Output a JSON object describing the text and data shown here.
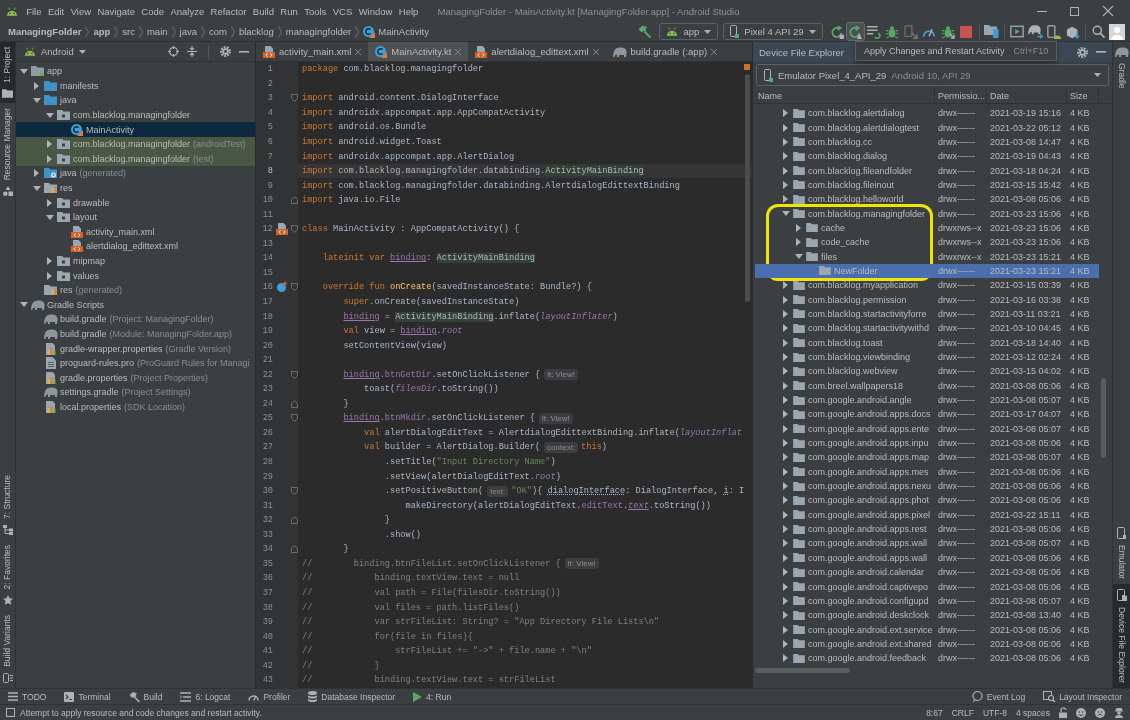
{
  "window": {
    "title": "ManagingFolder - MainActivity.kt [ManagingFolder.app] - Android Studio"
  },
  "menu": [
    "File",
    "Edit",
    "View",
    "Navigate",
    "Code",
    "Analyze",
    "Refactor",
    "Build",
    "Run",
    "Tools",
    "VCS",
    "Window",
    "Help"
  ],
  "breadcrumbs": [
    {
      "label": "ManagingFolder",
      "kind": "module"
    },
    {
      "label": "app",
      "kind": "module"
    },
    {
      "label": "src",
      "kind": "folder"
    },
    {
      "label": "main",
      "kind": "folder"
    },
    {
      "label": "java",
      "kind": "folder"
    },
    {
      "label": "com",
      "kind": "folder"
    },
    {
      "label": "blacklog",
      "kind": "folder"
    },
    {
      "label": "managingfolder",
      "kind": "folder"
    },
    {
      "label": "MainActivity",
      "kind": "class"
    }
  ],
  "run_toolbar": {
    "configuration": "app",
    "device": "Pixel 4 API 29",
    "button_groups": [
      [
        {
          "kind": "apply-code-changes",
          "hovered": false
        },
        {
          "kind": "apply-changes-restart",
          "hovered": true
        },
        {
          "kind": "coverage",
          "hovered": false
        },
        {
          "kind": "debug",
          "hovered": false
        },
        {
          "kind": "attach",
          "hovered": false
        },
        {
          "kind": "profile",
          "hovered": false
        },
        {
          "kind": "attach-debugger",
          "hovered": false
        },
        {
          "kind": "stop",
          "hovered": false
        }
      ],
      [
        {
          "kind": "device-files",
          "hovered": false
        }
      ],
      [
        {
          "kind": "terminal",
          "hovered": false
        },
        {
          "kind": "sync",
          "hovered": false
        },
        {
          "kind": "avd",
          "hovered": false
        },
        {
          "kind": "sdk",
          "hovered": false
        }
      ],
      [
        {
          "kind": "search",
          "hovered": false
        },
        {
          "kind": "account",
          "hovered": false
        }
      ]
    ]
  },
  "tooltip": {
    "text": "Apply Changes and Restart Activity",
    "shortcut": "Ctrl+F10"
  },
  "left_tool_tabs": {
    "top": [
      {
        "label": "1: Project",
        "kind": "project",
        "selected": true
      },
      {
        "label": "Resource Manager",
        "kind": "resources",
        "selected": false
      }
    ],
    "bottom": [
      {
        "label": "7: Structure",
        "kind": "structure",
        "selected": false
      },
      {
        "label": "2: Favorites",
        "kind": "favorites",
        "selected": false
      },
      {
        "label": "Build Variants",
        "kind": "variants",
        "selected": false
      }
    ]
  },
  "project_panel": {
    "view": "Android",
    "tree": [
      {
        "label": "app",
        "kind": "module",
        "expanded": true,
        "selected": false,
        "test_scope": false,
        "children": [
          {
            "label": "manifests",
            "kind": "folder",
            "expanded": false,
            "selected": false,
            "test_scope": false
          },
          {
            "label": "java",
            "kind": "folder",
            "expanded": true,
            "selected": false,
            "test_scope": false,
            "children": [
              {
                "label": "com.blacklog.managingfolder",
                "kind": "package",
                "expanded": true,
                "selected": false,
                "test_scope": false,
                "children": [
                  {
                    "label": "MainActivity",
                    "kind": "kotlin-class",
                    "selected": true,
                    "test_scope": false
                  }
                ]
              },
              {
                "label": "com.blacklog.managingfolder",
                "note": "(androidTest)",
                "kind": "package",
                "expanded": false,
                "selected": false,
                "test_scope": true
              },
              {
                "label": "com.blacklog.managingfolder",
                "note": "(test)",
                "kind": "package",
                "expanded": false,
                "selected": false,
                "test_scope": true
              }
            ]
          },
          {
            "label": "java",
            "note": "(generated)",
            "kind": "generated-folder",
            "expanded": false,
            "selected": false,
            "test_scope": false
          },
          {
            "label": "res",
            "kind": "res-folder",
            "expanded": true,
            "selected": false,
            "test_scope": false,
            "children": [
              {
                "label": "drawable",
                "kind": "package",
                "expanded": false,
                "selected": false,
                "test_scope": false
              },
              {
                "label": "layout",
                "kind": "package",
                "expanded": true,
                "selected": false,
                "test_scope": false,
                "children": [
                  {
                    "label": "activity_main.xml",
                    "kind": "xml",
                    "selected": false,
                    "test_scope": false
                  },
                  {
                    "label": "alertdialog_edittext.xml",
                    "kind": "xml",
                    "selected": false,
                    "test_scope": false
                  }
                ]
              },
              {
                "label": "mipmap",
                "kind": "package",
                "expanded": false,
                "selected": false,
                "test_scope": false
              },
              {
                "label": "values",
                "kind": "package",
                "expanded": false,
                "selected": false,
                "test_scope": false
              }
            ]
          },
          {
            "label": "res",
            "note": "(generated)",
            "kind": "res-folder",
            "selected": false,
            "test_scope": false
          }
        ]
      },
      {
        "label": "Gradle Scripts",
        "kind": "gradle",
        "expanded": true,
        "selected": false,
        "test_scope": false,
        "children": [
          {
            "label": "build.gradle",
            "note": "(Project: ManagingFolder)",
            "kind": "gradle",
            "selected": false,
            "test_scope": false
          },
          {
            "label": "build.gradle",
            "note": "(Module: ManagingFolder.app)",
            "kind": "gradle",
            "selected": false,
            "test_scope": false
          },
          {
            "label": "gradle-wrapper.properties",
            "note": "(Gradle Version)",
            "kind": "properties",
            "selected": false,
            "test_scope": false
          },
          {
            "label": "proguard-rules.pro",
            "note": "(ProGuard Rules for Managi",
            "kind": "text",
            "selected": false,
            "test_scope": false
          },
          {
            "label": "gradle.properties",
            "note": "(Project Properties)",
            "kind": "properties",
            "selected": false,
            "test_scope": false
          },
          {
            "label": "settings.gradle",
            "note": "(Project Settings)",
            "kind": "gradle",
            "selected": false,
            "test_scope": false
          },
          {
            "label": "local.properties",
            "note": "(SDK Location)",
            "kind": "properties",
            "selected": false,
            "test_scope": false
          }
        ]
      }
    ]
  },
  "editor": {
    "tabs": [
      {
        "label": "activity_main.xml",
        "kind": "xml",
        "selected": false
      },
      {
        "label": "MainActivity.kt",
        "kind": "kotlin",
        "selected": true
      },
      {
        "label": "alertdialog_edittext.xml",
        "kind": "xml",
        "selected": false
      },
      {
        "label": "build.gradle (:app)",
        "kind": "gradle",
        "selected": false
      }
    ],
    "lines": [
      {
        "number": "1",
        "current": false,
        "tokens": [
          {
            "kind": "keyword",
            "text": "package"
          },
          {
            "kind": "plain",
            "text": " com.blacklog.managingfolder"
          }
        ]
      },
      {
        "number": "2",
        "current": false
      },
      {
        "number": "3",
        "current": false,
        "fold_marker": {
          "kind": "start"
        },
        "tokens": [
          {
            "kind": "keyword",
            "text": "import"
          },
          {
            "kind": "plain",
            "text": " android.content.DialogInterface"
          }
        ]
      },
      {
        "number": "4",
        "current": false,
        "tokens": [
          {
            "kind": "keyword",
            "text": "import"
          },
          {
            "kind": "plain",
            "text": " androidx.appcompat.app.AppCompatActivity"
          }
        ]
      },
      {
        "number": "5",
        "current": false,
        "tokens": [
          {
            "kind": "keyword",
            "text": "import"
          },
          {
            "kind": "plain",
            "text": " android.os.Bundle"
          }
        ]
      },
      {
        "number": "6",
        "current": false,
        "tokens": [
          {
            "kind": "keyword",
            "text": "import"
          },
          {
            "kind": "plain",
            "text": " android.widget.Toast"
          }
        ]
      },
      {
        "number": "7",
        "current": false,
        "tokens": [
          {
            "kind": "keyword",
            "text": "import"
          },
          {
            "kind": "plain",
            "text": " androidx.appcompat.app.AlertDialog"
          }
        ]
      },
      {
        "number": "8",
        "current": true,
        "tokens": [
          {
            "kind": "keyword",
            "text": "import"
          },
          {
            "kind": "plain",
            "text": " com.blacklog.managingfolder.databinding."
          },
          {
            "kind": "type-highlight",
            "text": "ActivityMainBinding"
          }
        ]
      },
      {
        "number": "9",
        "current": false,
        "tokens": [
          {
            "kind": "keyword",
            "text": "import"
          },
          {
            "kind": "plain",
            "text": " com.blacklog.managingfolder.databinding.AlertdialogEdittextBinding"
          }
        ]
      },
      {
        "number": "10",
        "current": false,
        "fold_marker": {
          "kind": "end"
        },
        "tokens": [
          {
            "kind": "keyword",
            "text": "import"
          },
          {
            "kind": "plain",
            "text": " java.io.File"
          }
        ]
      },
      {
        "number": "11",
        "current": false
      },
      {
        "number": "12",
        "current": false,
        "fold_marker": {
          "kind": "start"
        },
        "gutter_marker": {
          "kind": "layout"
        },
        "tokens": [
          {
            "kind": "keyword",
            "text": "class"
          },
          {
            "kind": "plain",
            "text": " MainActivity : AppCompatActivity() {"
          }
        ]
      },
      {
        "number": "13",
        "current": false
      },
      {
        "number": "14",
        "current": false,
        "tokens": [
          {
            "kind": "keyword",
            "text": "    lateinit var "
          },
          {
            "kind": "property-underlined",
            "text": "binding"
          },
          {
            "kind": "plain",
            "text": ": "
          },
          {
            "kind": "type-highlight",
            "text": "ActivityMainBinding"
          }
        ]
      },
      {
        "number": "15",
        "current": false
      },
      {
        "number": "16",
        "current": false,
        "fold_marker": {
          "kind": "start"
        },
        "gutter_marker": {
          "kind": "override"
        },
        "tokens": [
          {
            "kind": "keyword",
            "text": "    override fun "
          },
          {
            "kind": "function",
            "text": "onCreate"
          },
          {
            "kind": "plain",
            "text": "(savedInstanceState: Bundle?) {"
          }
        ]
      },
      {
        "number": "17",
        "current": false,
        "tokens": [
          {
            "kind": "keyword",
            "text": "        super"
          },
          {
            "kind": "plain",
            "text": ".onCreate(savedInstanceState)"
          }
        ]
      },
      {
        "number": "18",
        "current": false,
        "tokens": [
          {
            "kind": "property-underlined",
            "text": "        binding"
          },
          {
            "kind": "plain",
            "text": " = "
          },
          {
            "kind": "type-highlight",
            "text": "ActivityMainBinding"
          },
          {
            "kind": "plain",
            "text": ".inflate("
          },
          {
            "kind": "property-italic",
            "text": "layoutInflater"
          },
          {
            "kind": "plain",
            "text": ")"
          }
        ]
      },
      {
        "number": "19",
        "current": false,
        "tokens": [
          {
            "kind": "keyword",
            "text": "        val"
          },
          {
            "kind": "plain",
            "text": " view = "
          },
          {
            "kind": "property-underlined",
            "text": "binding"
          },
          {
            "kind": "plain",
            "text": "."
          },
          {
            "kind": "property-italic",
            "text": "root"
          }
        ]
      },
      {
        "number": "20",
        "current": false,
        "tokens": [
          {
            "kind": "plain",
            "text": "        setContentView(view)"
          }
        ]
      },
      {
        "number": "21",
        "current": false
      },
      {
        "number": "22",
        "current": false,
        "fold_marker": {
          "kind": "start"
        },
        "tokens": [
          {
            "kind": "property-underlined",
            "text": "        binding"
          },
          {
            "kind": "plain",
            "text": "."
          },
          {
            "kind": "property",
            "text": "btnGetDir"
          },
          {
            "kind": "plain",
            "text": ".setOnClickListener {"
          },
          {
            "kind": "hint",
            "text": "it: View!"
          }
        ]
      },
      {
        "number": "23",
        "current": false,
        "tokens": [
          {
            "kind": "plain",
            "text": "            toast("
          },
          {
            "kind": "property-italic",
            "text": "filesDir"
          },
          {
            "kind": "plain",
            "text": ".toString())"
          }
        ]
      },
      {
        "number": "24",
        "current": false,
        "fold_marker": {
          "kind": "end"
        },
        "tokens": [
          {
            "kind": "plain",
            "text": "        }"
          }
        ]
      },
      {
        "number": "25",
        "current": false,
        "fold_marker": {
          "kind": "start"
        },
        "tokens": [
          {
            "kind": "property-underlined",
            "text": "        binding"
          },
          {
            "kind": "plain",
            "text": "."
          },
          {
            "kind": "property",
            "text": "btnMkdir"
          },
          {
            "kind": "plain",
            "text": ".setOnClickListener {"
          },
          {
            "kind": "hint",
            "text": "it: View!"
          }
        ]
      },
      {
        "number": "26",
        "current": false,
        "tokens": [
          {
            "kind": "keyword",
            "text": "            val"
          },
          {
            "kind": "plain",
            "text": " alertDialogEditText = AlertdialogEdittextBinding.inflate("
          },
          {
            "kind": "property-italic",
            "text": "layoutInflat"
          }
        ]
      },
      {
        "number": "27",
        "current": false,
        "tokens": [
          {
            "kind": "keyword",
            "text": "            val"
          },
          {
            "kind": "plain",
            "text": " builder = AlertDialog.Builder("
          },
          {
            "kind": "hint",
            "text": "context:"
          },
          {
            "kind": "keyword",
            "text": "this"
          },
          {
            "kind": "plain",
            "text": ")"
          }
        ]
      },
      {
        "number": "28",
        "current": false,
        "tokens": [
          {
            "kind": "plain",
            "text": "                .setTitle("
          },
          {
            "kind": "string",
            "text": "\"Input Directory Name\""
          },
          {
            "kind": "plain",
            "text": ")"
          }
        ]
      },
      {
        "number": "29",
        "current": false,
        "tokens": [
          {
            "kind": "plain",
            "text": "                .setView(alertDialogEditText."
          },
          {
            "kind": "property-italic",
            "text": "root"
          },
          {
            "kind": "plain",
            "text": ")"
          }
        ]
      },
      {
        "number": "30",
        "current": false,
        "fold_marker": {
          "kind": "start"
        },
        "tokens": [
          {
            "kind": "plain",
            "text": "                .setPositiveButton("
          },
          {
            "kind": "hint",
            "text": "text:"
          },
          {
            "kind": "string",
            "text": "\"OK\""
          },
          {
            "kind": "plain",
            "text": "){ "
          },
          {
            "kind": "parameter-underlined",
            "text": "dialogInterface"
          },
          {
            "kind": "plain",
            "text": ": DialogInterface, "
          },
          {
            "kind": "parameter-underlined",
            "text": "i"
          },
          {
            "kind": "plain",
            "text": ": I"
          }
        ]
      },
      {
        "number": "31",
        "current": false,
        "tokens": [
          {
            "kind": "plain",
            "text": "                    makeDirectory(alertDialogEditText."
          },
          {
            "kind": "property",
            "text": "editText"
          },
          {
            "kind": "plain",
            "text": "."
          },
          {
            "kind": "property-italic-underlined",
            "text": "text"
          },
          {
            "kind": "plain",
            "text": ".toString())"
          }
        ]
      },
      {
        "number": "32",
        "current": false,
        "fold_marker": {
          "kind": "end"
        },
        "tokens": [
          {
            "kind": "plain",
            "text": "                }"
          }
        ]
      },
      {
        "number": "33",
        "current": false,
        "tokens": [
          {
            "kind": "plain",
            "text": "                .show()"
          }
        ]
      },
      {
        "number": "34",
        "current": false,
        "fold_marker": {
          "kind": "end"
        },
        "tokens": [
          {
            "kind": "plain",
            "text": "        }"
          }
        ]
      },
      {
        "number": "35",
        "current": false,
        "tokens": [
          {
            "kind": "comment",
            "text": "//        binding.btnFileList.setOnClickListener {"
          },
          {
            "kind": "hint",
            "text": "it: View!"
          }
        ]
      },
      {
        "number": "36",
        "current": false,
        "tokens": [
          {
            "kind": "comment",
            "text": "//            binding.textView.text = null"
          }
        ]
      },
      {
        "number": "37",
        "current": false,
        "tokens": [
          {
            "kind": "comment",
            "text": "//            val path = File(filesDir.toString())"
          }
        ]
      },
      {
        "number": "38",
        "current": false,
        "tokens": [
          {
            "kind": "comment",
            "text": "//            val files = path.listFiles()"
          }
        ]
      },
      {
        "number": "39",
        "current": false,
        "tokens": [
          {
            "kind": "comment",
            "text": "//            var strFileList: String? = \"App Directory File Lists\\n\""
          }
        ]
      },
      {
        "number": "40",
        "current": false,
        "tokens": [
          {
            "kind": "comment",
            "text": "//            for(file in files){"
          }
        ]
      },
      {
        "number": "41",
        "current": false,
        "tokens": [
          {
            "kind": "comment",
            "text": "//                strFileList += \"->\" + file.name + \"\\n\""
          }
        ]
      },
      {
        "number": "42",
        "current": false,
        "tokens": [
          {
            "kind": "comment",
            "text": "//            }"
          }
        ]
      },
      {
        "number": "43",
        "current": false,
        "tokens": [
          {
            "kind": "comment",
            "text": "//            binding.textView.text = strFileList"
          }
        ]
      }
    ]
  },
  "device_explorer": {
    "title": "Device File Explorer",
    "device": {
      "name": "Emulator Pixel_4_API_29",
      "detail": "Android 10, API 29"
    },
    "columns": [
      "Name",
      "Permissio...",
      "Date",
      "Size"
    ],
    "rows": [
      {
        "name": "com.blacklog.alertdialog",
        "permissions": "drwx------",
        "date": "2021-03-19 15:16",
        "size": "4 KB",
        "expanded": false,
        "selected": false,
        "annotated": false
      },
      {
        "name": "com.blacklog.alertdialogtest",
        "permissions": "drwx------",
        "date": "2021-03-22 05:12",
        "size": "4 KB",
        "expanded": false,
        "selected": false,
        "annotated": false
      },
      {
        "name": "com.blacklog.cc",
        "permissions": "drwx------",
        "date": "2021-03-08 14:47",
        "size": "4 KB",
        "expanded": false,
        "selected": false,
        "annotated": false
      },
      {
        "name": "com.blacklog.dialog",
        "permissions": "drwx------",
        "date": "2021-03-19 04:43",
        "size": "4 KB",
        "expanded": false,
        "selected": false,
        "annotated": false
      },
      {
        "name": "com.blacklog.fileandfolder",
        "permissions": "drwx------",
        "date": "2021-03-18 04:24",
        "size": "4 KB",
        "expanded": false,
        "selected": false,
        "annotated": false
      },
      {
        "name": "com.blacklog.fileinout",
        "permissions": "drwx------",
        "date": "2021-03-15 15:42",
        "size": "4 KB",
        "expanded": false,
        "selected": false,
        "annotated": false
      },
      {
        "name": "com.blacklog.helloworld",
        "permissions": "drwx------",
        "date": "2021-03-08 05:06",
        "size": "4 KB",
        "expanded": false,
        "selected": false,
        "annotated": false
      },
      {
        "name": "com.blacklog.managingfolder",
        "permissions": "drwx------",
        "date": "2021-03-23 15:06",
        "size": "4 KB",
        "expanded": true,
        "selected": false,
        "annotated": true,
        "children": [
          {
            "name": "cache",
            "permissions": "drwxrws--x",
            "date": "2021-03-23 15:06",
            "size": "4 KB",
            "expanded": false,
            "selected": false,
            "annotated": false
          },
          {
            "name": "code_cache",
            "permissions": "drwxrws--x",
            "date": "2021-03-23 15:06",
            "size": "4 KB",
            "expanded": false,
            "selected": false,
            "annotated": false
          },
          {
            "name": "files",
            "permissions": "drwxrwx--x",
            "date": "2021-03-23 15:21",
            "size": "4 KB",
            "expanded": true,
            "selected": false,
            "annotated": false,
            "children": [
              {
                "name": "NewFolder",
                "permissions": "drwx------",
                "date": "2021-03-23 15:21",
                "size": "4 KB",
                "selected": true,
                "annotated": false
              }
            ]
          }
        ]
      },
      {
        "name": "com.blacklog.myapplication",
        "permissions": "drwx------",
        "date": "2021-03-15 03:39",
        "size": "4 KB",
        "expanded": false,
        "selected": false,
        "annotated": false
      },
      {
        "name": "com.blacklog.permission",
        "permissions": "drwx------",
        "date": "2021-03-16 03:38",
        "size": "4 KB",
        "expanded": false,
        "selected": false,
        "annotated": false
      },
      {
        "name": "com.blacklog.startactivityforre",
        "permissions": "drwx------",
        "date": "2021-03-11 03:21",
        "size": "4 KB",
        "expanded": false,
        "selected": false,
        "annotated": false
      },
      {
        "name": "com.blacklog.startactivitywithd",
        "permissions": "drwx------",
        "date": "2021-03-10 04:45",
        "size": "4 KB",
        "expanded": false,
        "selected": false,
        "annotated": false
      },
      {
        "name": "com.blacklog.toast",
        "permissions": "drwx------",
        "date": "2021-03-18 14:40",
        "size": "4 KB",
        "expanded": false,
        "selected": false,
        "annotated": false
      },
      {
        "name": "com.blacklog.viewbinding",
        "permissions": "drwx------",
        "date": "2021-03-12 02:24",
        "size": "4 KB",
        "expanded": false,
        "selected": false,
        "annotated": false
      },
      {
        "name": "com.blacklog.webview",
        "permissions": "drwx------",
        "date": "2021-03-15 04:02",
        "size": "4 KB",
        "expanded": false,
        "selected": false,
        "annotated": false
      },
      {
        "name": "com.breel.wallpapers18",
        "permissions": "drwx------",
        "date": "2021-03-08 05:06",
        "size": "4 KB",
        "expanded": false,
        "selected": false,
        "annotated": false
      },
      {
        "name": "com.google.android.angle",
        "permissions": "drwx------",
        "date": "2021-03-08 05:07",
        "size": "4 KB",
        "expanded": false,
        "selected": false,
        "annotated": false
      },
      {
        "name": "com.google.android.apps.docs",
        "permissions": "drwx------",
        "date": "2021-03-17 04:07",
        "size": "4 KB",
        "expanded": false,
        "selected": false,
        "annotated": false
      },
      {
        "name": "com.google.android.apps.ente",
        "permissions": "drwx------",
        "date": "2021-03-08 05:07",
        "size": "4 KB",
        "expanded": false,
        "selected": false,
        "annotated": false
      },
      {
        "name": "com.google.android.apps.inpu",
        "permissions": "drwx------",
        "date": "2021-03-08 05:06",
        "size": "4 KB",
        "expanded": false,
        "selected": false,
        "annotated": false
      },
      {
        "name": "com.google.android.apps.map",
        "permissions": "drwx------",
        "date": "2021-03-08 05:07",
        "size": "4 KB",
        "expanded": false,
        "selected": false,
        "annotated": false
      },
      {
        "name": "com.google.android.apps.mes",
        "permissions": "drwx------",
        "date": "2021-03-08 05:06",
        "size": "4 KB",
        "expanded": false,
        "selected": false,
        "annotated": false
      },
      {
        "name": "com.google.android.apps.nexu",
        "permissions": "drwx------",
        "date": "2021-03-08 05:06",
        "size": "4 KB",
        "expanded": false,
        "selected": false,
        "annotated": false
      },
      {
        "name": "com.google.android.apps.phot",
        "permissions": "drwx------",
        "date": "2021-03-08 05:06",
        "size": "4 KB",
        "expanded": false,
        "selected": false,
        "annotated": false
      },
      {
        "name": "com.google.android.apps.pixel",
        "permissions": "drwx------",
        "date": "2021-03-22 15:11",
        "size": "4 KB",
        "expanded": false,
        "selected": false,
        "annotated": false
      },
      {
        "name": "com.google.android.apps.rest",
        "permissions": "drwx------",
        "date": "2021-03-08 05:06",
        "size": "4 KB",
        "expanded": false,
        "selected": false,
        "annotated": false
      },
      {
        "name": "com.google.android.apps.wall",
        "permissions": "drwx------",
        "date": "2021-03-08 05:07",
        "size": "4 KB",
        "expanded": false,
        "selected": false,
        "annotated": false
      },
      {
        "name": "com.google.android.apps.wall",
        "permissions": "drwx------",
        "date": "2021-03-08 05:06",
        "size": "4 KB",
        "expanded": false,
        "selected": false,
        "annotated": false
      },
      {
        "name": "com.google.android.calendar",
        "permissions": "drwx------",
        "date": "2021-03-08 05:06",
        "size": "4 KB",
        "expanded": false,
        "selected": false,
        "annotated": false
      },
      {
        "name": "com.google.android.captivepo",
        "permissions": "drwx------",
        "date": "2021-03-08 05:06",
        "size": "4 KB",
        "expanded": false,
        "selected": false,
        "annotated": false
      },
      {
        "name": "com.google.android.configupd",
        "permissions": "drwx------",
        "date": "2021-03-08 05:07",
        "size": "4 KB",
        "expanded": false,
        "selected": false,
        "annotated": false
      },
      {
        "name": "com.google.android.deskclock",
        "permissions": "drwx------",
        "date": "2021-03-08 13:40",
        "size": "4 KB",
        "expanded": false,
        "selected": false,
        "annotated": false
      },
      {
        "name": "com.google.android.ext.service",
        "permissions": "drwx------",
        "date": "2021-03-08 05:06",
        "size": "4 KB",
        "expanded": false,
        "selected": false,
        "annotated": false
      },
      {
        "name": "com.google.android.ext.shared",
        "permissions": "drwx------",
        "date": "2021-03-08 05:06",
        "size": "4 KB",
        "expanded": false,
        "selected": false,
        "annotated": false
      },
      {
        "name": "com.google.android.feedback",
        "permissions": "drwx------",
        "date": "2021-03-08 05:06",
        "size": "4 KB",
        "expanded": false,
        "selected": false,
        "annotated": false
      }
    ]
  },
  "right_tool_tabs": {
    "top": [
      {
        "label": "Gradle",
        "kind": "gradle",
        "selected": false
      }
    ],
    "bottom": [
      {
        "label": "Emulator",
        "kind": "emulator",
        "selected": false
      },
      {
        "label": "Device File Explorer",
        "kind": "device-files",
        "selected": true
      }
    ]
  },
  "tool_window_bar": {
    "left": [
      {
        "label": "TODO",
        "kind": "todo"
      },
      {
        "label": "Terminal",
        "kind": "terminal"
      },
      {
        "label": "Build",
        "kind": "build"
      },
      {
        "label": "6: Logcat",
        "kind": "logcat"
      },
      {
        "label": "Profiler",
        "kind": "profiler"
      },
      {
        "label": "Database Inspector",
        "kind": "database"
      },
      {
        "label": "4: Run",
        "kind": "run"
      }
    ],
    "right": [
      {
        "label": "Event Log",
        "kind": "event-log"
      },
      {
        "label": "Layout Inspector",
        "kind": "layout-inspector"
      }
    ]
  },
  "status_bar": {
    "message": "Attempt to apply resource and code changes and restart activity.",
    "position": "8:67",
    "line_separator": "CRLF",
    "encoding": "UTF-8",
    "indent": "4 spaces"
  }
}
